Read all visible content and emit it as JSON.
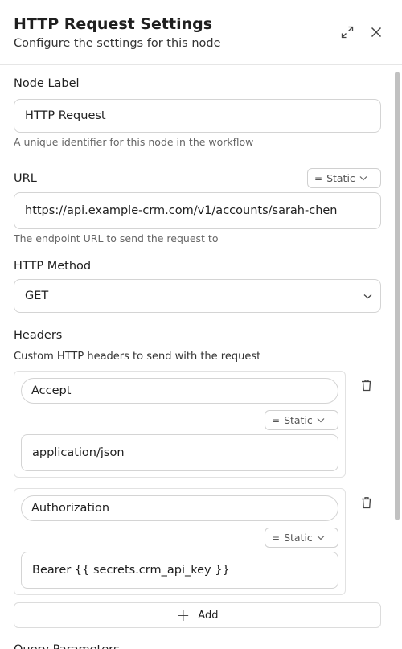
{
  "header": {
    "title": "HTTP Request Settings",
    "subtitle": "Configure the settings for this node"
  },
  "node_label": {
    "label": "Node Label",
    "value": "HTTP Request",
    "hint": "A unique identifier for this node in the workflow"
  },
  "url": {
    "label": "URL",
    "mode": "Static",
    "value": "https://api.example-crm.com/v1/accounts/sarah-chen",
    "hint": "The endpoint URL to send the request to"
  },
  "method": {
    "label": "HTTP Method",
    "value": "GET"
  },
  "headers": {
    "label": "Headers",
    "description": "Custom HTTP headers to send with the request",
    "items": [
      {
        "key": "Accept",
        "mode": "Static",
        "value": "application/json"
      },
      {
        "key": "Authorization",
        "mode": "Static",
        "value": "Bearer {{ secrets.crm_api_key }}"
      }
    ],
    "add_label": "Add"
  },
  "next_section": {
    "label": "Query Parameters"
  }
}
